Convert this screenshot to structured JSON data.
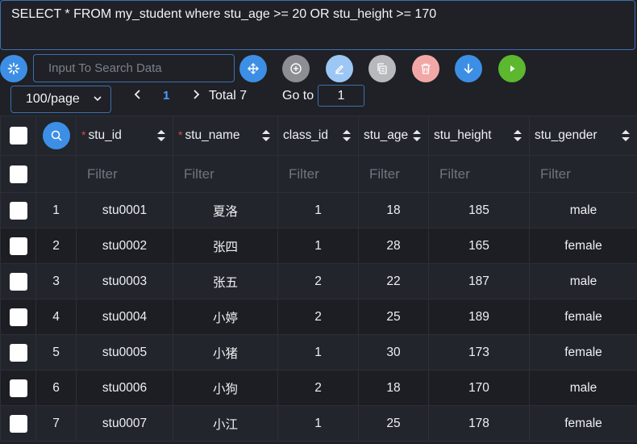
{
  "query": "SELECT * FROM my_student where stu_age >= 20 OR  stu_height >= 170",
  "search": {
    "placeholder": "Input To Search Data"
  },
  "toolbar": {
    "buttons": [
      {
        "name": "refresh-button",
        "icon": "loading-spinner-icon",
        "color": "#3d8fe6"
      },
      {
        "name": "move-button",
        "icon": "move-icon",
        "color": "#3d8fe6"
      },
      {
        "name": "add-button",
        "icon": "plus-circle-icon",
        "color": "#8c8e93"
      },
      {
        "name": "edit-button",
        "icon": "edit-icon",
        "color": "#9cc7f5"
      },
      {
        "name": "copy-button",
        "icon": "copy-icon",
        "color": "#b8b9bc"
      },
      {
        "name": "delete-button",
        "icon": "trash-icon",
        "color": "#f2a7a7"
      },
      {
        "name": "download-button",
        "icon": "arrow-down-icon",
        "color": "#3d8fe6"
      },
      {
        "name": "run-button",
        "icon": "play-icon",
        "color": "#5cb82f"
      }
    ]
  },
  "pagination": {
    "page_size": "100/page",
    "current_page": "1",
    "total": "Total 7",
    "goto_label": "Go to",
    "goto_value": "1"
  },
  "table": {
    "columns": [
      {
        "label": "stu_id",
        "required": true
      },
      {
        "label": "stu_name",
        "required": true
      },
      {
        "label": "class_id",
        "required": false
      },
      {
        "label": "stu_age",
        "required": false
      },
      {
        "label": "stu_height",
        "required": false
      },
      {
        "label": "stu_gender",
        "required": false
      }
    ],
    "filter_placeholder": "Filter",
    "rows": [
      {
        "index": "1",
        "stu_id": "stu0001",
        "stu_name": "夏洛",
        "class_id": "1",
        "stu_age": "18",
        "stu_height": "185",
        "stu_gender": "male"
      },
      {
        "index": "2",
        "stu_id": "stu0002",
        "stu_name": "张四",
        "class_id": "1",
        "stu_age": "28",
        "stu_height": "165",
        "stu_gender": "female"
      },
      {
        "index": "3",
        "stu_id": "stu0003",
        "stu_name": "张五",
        "class_id": "2",
        "stu_age": "22",
        "stu_height": "187",
        "stu_gender": "male"
      },
      {
        "index": "4",
        "stu_id": "stu0004",
        "stu_name": "小婷",
        "class_id": "2",
        "stu_age": "25",
        "stu_height": "189",
        "stu_gender": "female"
      },
      {
        "index": "5",
        "stu_id": "stu0005",
        "stu_name": "小猪",
        "class_id": "1",
        "stu_age": "30",
        "stu_height": "173",
        "stu_gender": "female"
      },
      {
        "index": "6",
        "stu_id": "stu0006",
        "stu_name": "小狗",
        "class_id": "2",
        "stu_age": "18",
        "stu_height": "170",
        "stu_gender": "male"
      },
      {
        "index": "7",
        "stu_id": "stu0007",
        "stu_name": "小江",
        "class_id": "1",
        "stu_age": "25",
        "stu_height": "178",
        "stu_gender": "female"
      }
    ]
  }
}
